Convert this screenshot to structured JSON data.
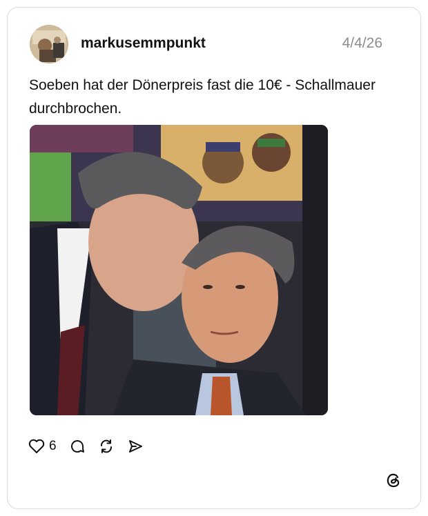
{
  "post": {
    "username": "markusemmpunkt",
    "timestamp": "4/4/26",
    "text": "Soeben hat der Dönerpreis fast die 10€ - Schallmauer durchbrochen.",
    "image_alt": "Photo of a man whispering into another man's ear in a classroom"
  },
  "actions": {
    "like_icon": "heart-icon",
    "like_count": "6",
    "reply_icon": "comment-icon",
    "repost_icon": "repost-icon",
    "share_icon": "send-icon"
  },
  "branding": {
    "logo_icon": "threads-logo-icon"
  },
  "colors": {
    "border": "#dcdcdc",
    "muted": "#8c8c8c",
    "text": "#111111"
  }
}
